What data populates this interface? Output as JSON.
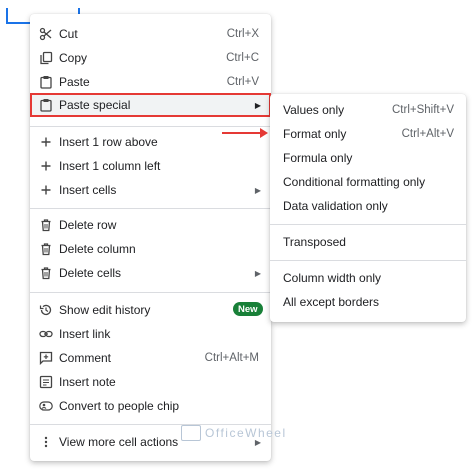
{
  "context_menu": {
    "items": [
      {
        "label": "Cut",
        "shortcut": "Ctrl+X",
        "icon": "scissors-icon"
      },
      {
        "label": "Copy",
        "shortcut": "Ctrl+C",
        "icon": "copy-icon"
      },
      {
        "label": "Paste",
        "shortcut": "Ctrl+V",
        "icon": "clipboard-icon"
      },
      {
        "label": "Paste special",
        "icon": "clipboard-icon"
      },
      {
        "label": "Insert 1 row above",
        "icon": "plus-icon"
      },
      {
        "label": "Insert 1 column left",
        "icon": "plus-icon"
      },
      {
        "label": "Insert cells",
        "icon": "plus-icon"
      },
      {
        "label": "Delete row",
        "icon": "trash-icon"
      },
      {
        "label": "Delete column",
        "icon": "trash-icon"
      },
      {
        "label": "Delete cells",
        "icon": "trash-icon"
      },
      {
        "label": "Show edit history",
        "badge": "New",
        "icon": "history-icon"
      },
      {
        "label": "Insert link",
        "icon": "link-icon"
      },
      {
        "label": "Comment",
        "shortcut": "Ctrl+Alt+M",
        "icon": "comment-icon"
      },
      {
        "label": "Insert note",
        "icon": "note-icon"
      },
      {
        "label": "Convert to people chip",
        "icon": "people-chip-icon"
      },
      {
        "label": "View more cell actions",
        "icon": "more-vert-icon"
      }
    ]
  },
  "paste_special_menu": {
    "items": [
      {
        "label": "Values only",
        "shortcut": "Ctrl+Shift+V"
      },
      {
        "label": "Format only",
        "shortcut": "Ctrl+Alt+V"
      },
      {
        "label": "Formula only"
      },
      {
        "label": "Conditional formatting only"
      },
      {
        "label": "Data validation only"
      },
      {
        "label": "Transposed"
      },
      {
        "label": "Column width only"
      },
      {
        "label": "All except borders"
      }
    ]
  },
  "watermark": "OfficeWheel",
  "colors": {
    "highlight": "#e53935",
    "badge": "#188038",
    "selection": "#1a73e8"
  }
}
